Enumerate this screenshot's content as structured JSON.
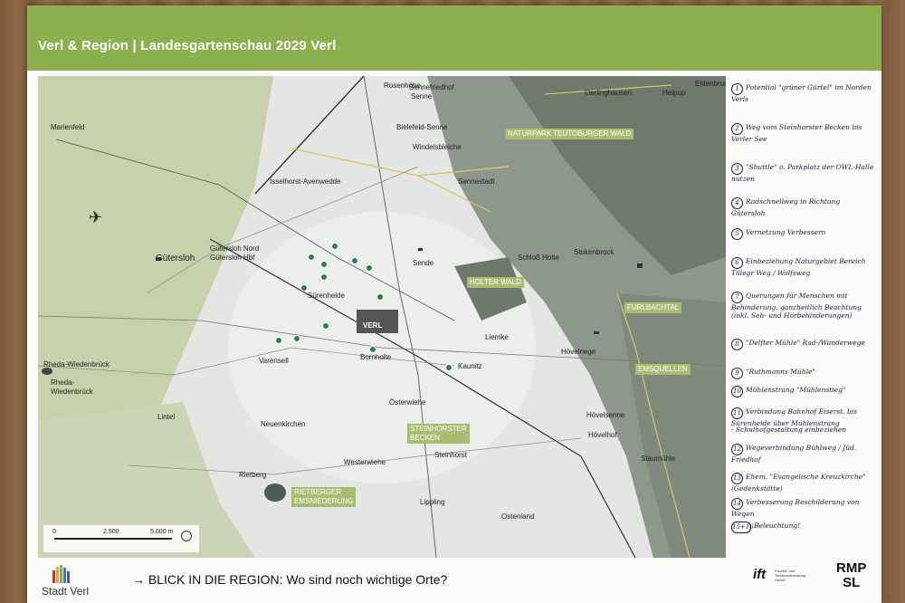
{
  "header": {
    "title": "Verl & Region | Landesgartenschau 2029 Verl",
    "color": "#8cb04d"
  },
  "map": {
    "places": [
      {
        "id": "rosenhoehe",
        "label": "Rosenhöhe"
      },
      {
        "id": "sennefriedhof",
        "label": "Sennefriedhof"
      },
      {
        "id": "senne",
        "label": "Senne"
      },
      {
        "id": "oerlinghausen",
        "label": "Oerlinghausen"
      },
      {
        "id": "helpup",
        "label": "Helpup"
      },
      {
        "id": "ehlenbruch",
        "label": "Ehlenbruch"
      },
      {
        "id": "marienfeld",
        "label": "Marienfeld"
      },
      {
        "id": "bielefeld-senne",
        "label": "Bielefeld-Senne"
      },
      {
        "id": "windelsbleiche",
        "label": "Windelsbleiche"
      },
      {
        "id": "isselhorst",
        "label": "Isselhorst-Avenwedde"
      },
      {
        "id": "sennestadt",
        "label": "Sennestadt"
      },
      {
        "id": "guetersloh-nord",
        "label": "Gütersloh Nord"
      },
      {
        "id": "guetersloh-hbf",
        "label": "Gütersloh Hbf"
      },
      {
        "id": "guetersloh",
        "label": "Gütersloh"
      },
      {
        "id": "sende",
        "label": "Sende"
      },
      {
        "id": "schloss-holte",
        "label": "Schloß Holte"
      },
      {
        "id": "stukenbrock",
        "label": "Stukenbrock"
      },
      {
        "id": "suerenheide",
        "label": "Sürenheide"
      },
      {
        "id": "rheda-bhf",
        "label": "Rheda-Wiedenbrück"
      },
      {
        "id": "varensell",
        "label": "Varensell"
      },
      {
        "id": "bornholte",
        "label": "Bornholte"
      },
      {
        "id": "liemke",
        "label": "Liemke"
      },
      {
        "id": "hoevelriege",
        "label": "Hövelriege"
      },
      {
        "id": "kaunitz",
        "label": "Kaunitz"
      },
      {
        "id": "rheda",
        "label": "Rheda-\nWiedenbrück"
      },
      {
        "id": "lintel",
        "label": "Lintel"
      },
      {
        "id": "oesterwiehe",
        "label": "Österwiehe"
      },
      {
        "id": "neuenkirchen",
        "label": "Neuenkirchen"
      },
      {
        "id": "hoevelsenne",
        "label": "Hövelsenne"
      },
      {
        "id": "hoevelhof",
        "label": "Hövelhof"
      },
      {
        "id": "westerwiehe",
        "label": "Westerwiehe"
      },
      {
        "id": "staumuehle",
        "label": "Staumühle"
      },
      {
        "id": "rietberg",
        "label": "Rietberg"
      },
      {
        "id": "steinhorst",
        "label": "Steinhorst"
      },
      {
        "id": "lippling",
        "label": "Lippling"
      },
      {
        "id": "ostenland",
        "label": "Ostenland"
      }
    ],
    "regions": {
      "naturpark": "NATURPARK TEUTOBURGER WALD",
      "holter": "HOLTER WALD",
      "furlbachtal": "FURLBACHTAL",
      "emsquellen": "EMSQUELLEN",
      "steinhorster": "STEINHORSTER\nBECKEN",
      "rietberger": "RIETBERGER\nEMSNIEDERUNG"
    },
    "verl": "VERL",
    "scale": {
      "t0": "0",
      "t1": "2.500",
      "t2": "5.000 m"
    }
  },
  "notes": [
    {
      "n": "1",
      "text": "Potential \"grüner Gürtel\" im Norden Verls"
    },
    {
      "n": "2",
      "text": "Weg vom Steinhorster Becken bis Verler See"
    },
    {
      "n": "3",
      "text": "\"Shuttle\" o. Parkplatz der OWL-Halle nutzen"
    },
    {
      "n": "4",
      "text": "Radschnellweg in Richtung Gütersloh"
    },
    {
      "n": "5",
      "text": "Vernetzung Verbessern"
    },
    {
      "n": "6",
      "text": "Einbeziehung Naturgebiet Bereich Tillegr Weg / Wolfsweg"
    },
    {
      "n": "7",
      "text": "Querungen für Menschen mit Behinderung, ganzheitlich Beachtung (inkl. Seh- und Hörbehinderungen)"
    },
    {
      "n": "8",
      "text": "\"Delfter Mühle\" Rad-/Wanderwege"
    },
    {
      "n": "9",
      "text": "\"Ruthmanns Mühle\""
    },
    {
      "n": "10",
      "text": "Mühlenstrang \"Mühlenstieg\""
    },
    {
      "n": "11",
      "text": "Verbindung Bahnhof Eiserst. bis Sürenheide über Mühlenstrang"
    },
    {
      "n": "-",
      "text": "- Schulhofgestaltung einbeziehen"
    },
    {
      "n": "12",
      "text": "Wegeverbindung Bühlweg / Jüd. Friedhof"
    },
    {
      "n": "13",
      "text": "Ehem. \"Evangelische Kreuzkirche\" (Gedenkstätte)"
    },
    {
      "n": "14",
      "text": "Verbesserung Beschilderung von Wegen"
    },
    {
      "n": "15+16",
      "text": "Beleuchtung!"
    }
  ],
  "footer": {
    "logo_text": "Stadt Verl",
    "prompt": "→ BLICK IN DIE REGION: Wo sind noch wichtige Orte?",
    "ift_mark": "ift",
    "ift_sub": "Freizeit- und Tourismusberatung GmbH",
    "rmp_line1": "RMP",
    "rmp_line2": "SL"
  }
}
